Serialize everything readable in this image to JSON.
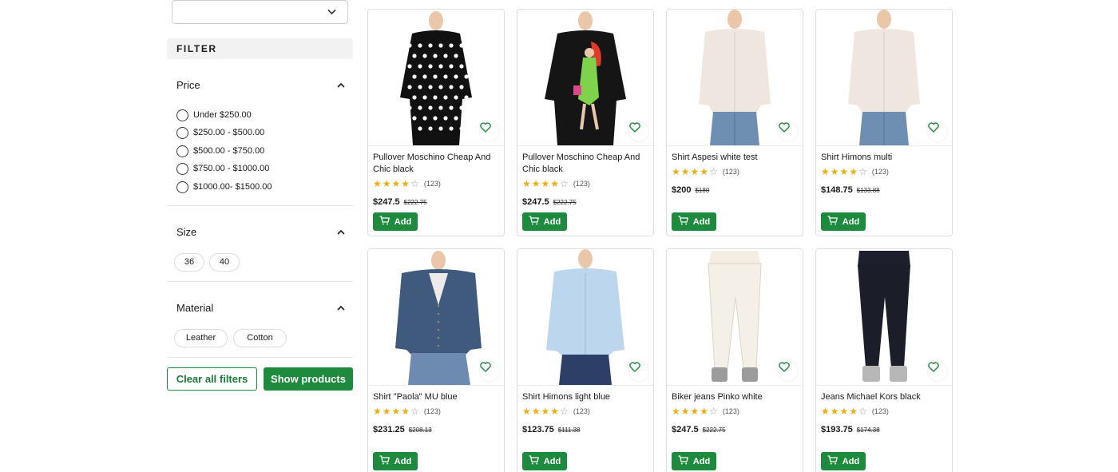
{
  "sort": {
    "value": ""
  },
  "filter": {
    "heading": "FILTER",
    "price": {
      "title": "Price",
      "options": [
        "Under $250.00",
        "$250.00 - $500.00",
        "$500.00 - $750.00",
        "$750.00 - $1000.00",
        "$1000.00- $1500.00"
      ]
    },
    "size": {
      "title": "Size",
      "options": [
        "36",
        "40"
      ]
    },
    "material": {
      "title": "Material",
      "options": [
        "Leather",
        "Cotton"
      ]
    },
    "clear_label": "Clear all filters",
    "show_label": "Show products"
  },
  "products": [
    {
      "name": "Pullover Moschino Cheap And Chic black",
      "rating": 4,
      "reviews": "(123)",
      "price": "$247.5",
      "old_price": "$222.75",
      "add_label": "Add",
      "image": "black-pullover-white-hearts"
    },
    {
      "name": "Pullover Moschino Cheap And Chic black",
      "rating": 4,
      "reviews": "(123)",
      "price": "$247.5",
      "old_price": "$222.75",
      "add_label": "Add",
      "image": "black-pullover-printed-girl"
    },
    {
      "name": "Shirt Aspesi white test",
      "rating": 4,
      "reviews": "(123)",
      "price": "$200",
      "old_price": "$180",
      "add_label": "Add",
      "image": "white-shirt-jeans"
    },
    {
      "name": "Shirt Himons multi",
      "rating": 4,
      "reviews": "(123)",
      "price": "$148.75",
      "old_price": "$133.88",
      "add_label": "Add",
      "image": "white-shirt-jeans"
    },
    {
      "name": "Shirt \"Paola\" MU blue",
      "rating": 4,
      "reviews": "(123)",
      "price": "$231.25",
      "old_price": "$208.13",
      "add_label": "Add",
      "image": "denim-shirt"
    },
    {
      "name": "Shirt Himons light blue",
      "rating": 4,
      "reviews": "(123)",
      "price": "$123.75",
      "old_price": "$111.38",
      "add_label": "Add",
      "image": "light-blue-shirt"
    },
    {
      "name": "Biker jeans Pinko white",
      "rating": 4,
      "reviews": "(123)",
      "price": "$247.5",
      "old_price": "$222.75",
      "add_label": "Add",
      "image": "white-jeans"
    },
    {
      "name": "Jeans Michael Kors black",
      "rating": 4,
      "reviews": "(123)",
      "price": "$193.75",
      "old_price": "$174.38",
      "add_label": "Add",
      "image": "black-jeans"
    }
  ],
  "colors": {
    "accent_green": "#1e8a3e",
    "star": "#e8b012"
  }
}
